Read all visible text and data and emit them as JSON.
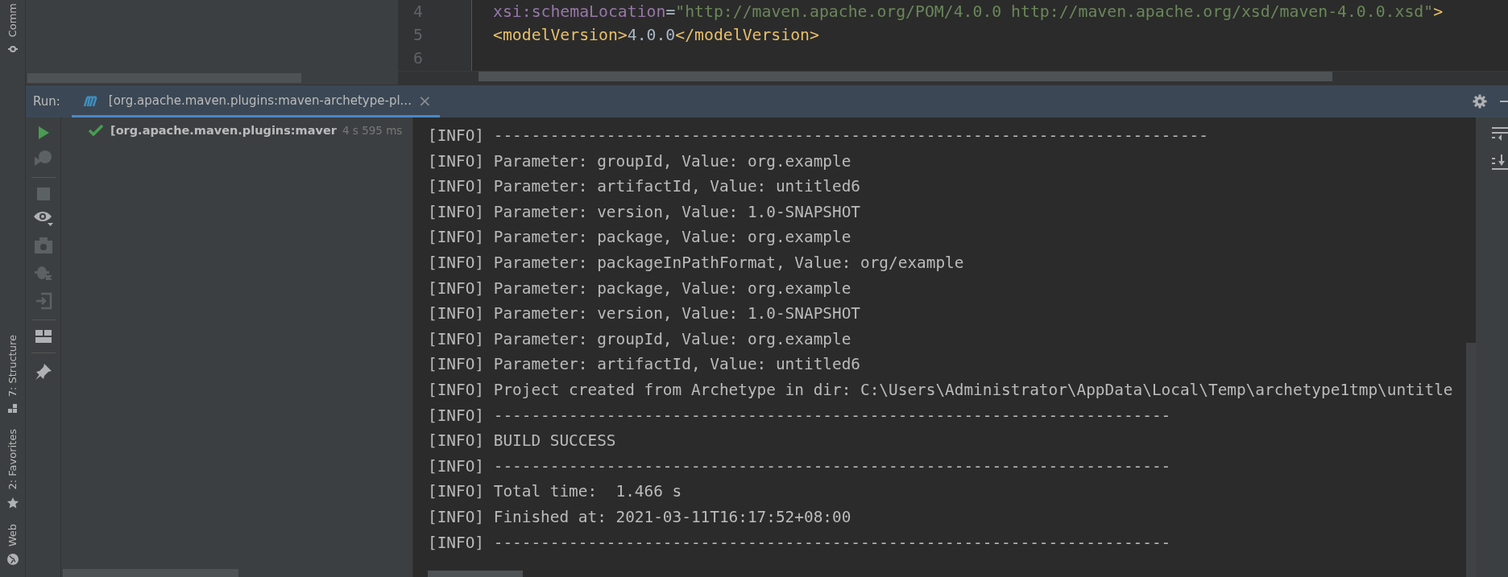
{
  "side_stripe": [
    {
      "kind": "commit",
      "label": "Comm"
    },
    {
      "kind": "structure",
      "label": "7: Structure"
    },
    {
      "kind": "favorites",
      "label": "2: Favorites"
    },
    {
      "kind": "web",
      "label": "Web"
    }
  ],
  "editor": {
    "lines": [
      {
        "number": "4",
        "tokens": [
          {
            "kind": "attr",
            "text": "xsi:schemaLocation"
          },
          {
            "kind": "text",
            "text": "="
          },
          {
            "kind": "string",
            "text": "\"http://maven.apache.org/POM/4.0.0 http://maven.apache.org/xsd/maven-4.0.0.xsd\""
          },
          {
            "kind": "tag",
            "text": ">"
          }
        ]
      },
      {
        "number": "5",
        "tokens": [
          {
            "kind": "tag",
            "text": "<modelVersion>"
          },
          {
            "kind": "text",
            "text": "4.0.0"
          },
          {
            "kind": "tag",
            "text": "</modelVersion>"
          }
        ]
      },
      {
        "number": "6"
      }
    ]
  },
  "run_panel": {
    "label": "Run:",
    "tabs": [
      {
        "label": "[org.apache.maven.plugins:maven-archetype-pl...",
        "selected": true,
        "close": "×"
      }
    ]
  },
  "toolbar": [
    {
      "kind": "run",
      "disabled": false
    },
    {
      "kind": "rerun",
      "disabled": true
    },
    {
      "kind": "separator"
    },
    {
      "kind": "stop",
      "disabled": true
    },
    {
      "kind": "eye",
      "disabled": false
    },
    {
      "kind": "camera",
      "disabled": true
    },
    {
      "kind": "bug",
      "disabled": true
    },
    {
      "kind": "import",
      "disabled": true
    },
    {
      "kind": "separator"
    },
    {
      "kind": "layout",
      "disabled": false
    },
    {
      "kind": "separator"
    },
    {
      "kind": "pin",
      "disabled": false
    }
  ],
  "tree": [
    {
      "label": "[org.apache.maven.plugins:maver",
      "duration": "4 s 595 ms"
    }
  ],
  "console": {
    "lines": [
      "[INFO] ----------------------------------------------------------------------------",
      "[INFO] Parameter: groupId, Value: org.example",
      "[INFO] Parameter: artifactId, Value: untitled6",
      "[INFO] Parameter: version, Value: 1.0-SNAPSHOT",
      "[INFO] Parameter: package, Value: org.example",
      "[INFO] Parameter: packageInPathFormat, Value: org/example",
      "[INFO] Parameter: package, Value: org.example",
      "[INFO] Parameter: version, Value: 1.0-SNAPSHOT",
      "[INFO] Parameter: groupId, Value: org.example",
      "[INFO] Parameter: artifactId, Value: untitled6",
      "[INFO] Project created from Archetype in dir: C:\\Users\\Administrator\\AppData\\Local\\Temp\\archetype1tmp\\untitle",
      "[INFO] ------------------------------------------------------------------------",
      "[INFO] BUILD SUCCESS",
      "[INFO] ------------------------------------------------------------------------",
      "[INFO] Total time:  1.466 s",
      "[INFO] Finished at: 2021-03-11T16:17:52+08:00",
      "[INFO] ------------------------------------------------------------------------"
    ]
  },
  "console_tools": [
    {
      "kind": "wrap"
    },
    {
      "kind": "scroll-end"
    }
  ]
}
